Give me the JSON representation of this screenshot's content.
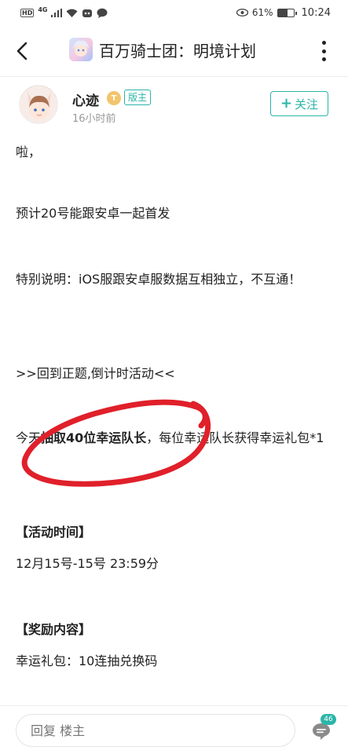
{
  "status_bar": {
    "hd": "HD",
    "network": "4G",
    "battery_text": "61%",
    "battery_level": 0.61,
    "time": "10:24"
  },
  "header": {
    "title": "百万骑士团：明境计划",
    "back_icon": "chevron-left-icon",
    "more_icon": "more-vertical-icon"
  },
  "author": {
    "name": "心迹",
    "level_badge": "T",
    "role": "版主",
    "time": "16小时前",
    "follow_label": "关注",
    "follow_plus": "+"
  },
  "post": {
    "p1": "啦，",
    "p2": "预计20号能跟安卓一起首发",
    "p3": "特别说明：iOS服跟安卓服数据互相独立，不互通！",
    "p4": ">>回到正题,倒计时活动<<",
    "p5_a": "今天",
    "p5_bold": "抽取40位幸运队长",
    "p5_b": "，每位幸运队长获得幸运礼包*1",
    "section_time_title": "【活动时间】",
    "section_time_value": "12月15号-15号 23:59分",
    "section_reward_title": "【奖励内容】",
    "section_reward_value": "幸运礼包：10连抽兑换码"
  },
  "colors": {
    "accent": "#2bb5a8",
    "annotation": "#e0202a",
    "badge_gold": "#f3c46b"
  },
  "bottom_bar": {
    "reply_placeholder": "回复 楼主",
    "comment_count": "46",
    "comment_icon": "comment-bubble-icon"
  }
}
